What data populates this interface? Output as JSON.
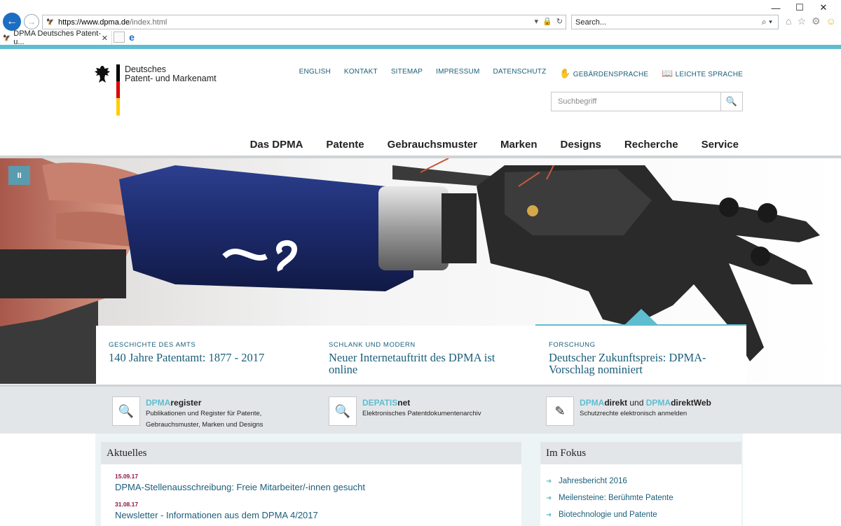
{
  "browser": {
    "url_host": "https://www.dpma.de",
    "url_path": "/index.html",
    "search_placeholder": "Search...",
    "tab_title": "DPMA Deutsches Patent- u..."
  },
  "header": {
    "logo_line1": "Deutsches",
    "logo_line2": "Patent- und Markenamt",
    "topnav": [
      "ENGLISH",
      "KONTAKT",
      "SITEMAP",
      "IMPRESSUM",
      "DATENSCHUTZ",
      "GEBÄRDENSPRACHE",
      "LEICHTE SPRACHE"
    ],
    "search_placeholder": "Suchbegriff",
    "mainnav": [
      "Das DPMA",
      "Patente",
      "Gebrauchsmuster",
      "Marken",
      "Designs",
      "Recherche",
      "Service"
    ]
  },
  "hero": {
    "pause_label": "II",
    "teasers": [
      {
        "kicker": "GESCHICHTE DES AMTS",
        "title": "140 Jahre Patentamt: 1877 - 2017"
      },
      {
        "kicker": "SCHLANK UND MODERN",
        "title": "Neuer Internetauftritt des DPMA ist online"
      },
      {
        "kicker": "FORSCHUNG",
        "title": "Deutscher Zukunftspreis: DPMA-Vorschlag nominiert"
      }
    ]
  },
  "services": [
    {
      "prefix": "DPMA",
      "suffix": "register",
      "desc1": "Publikationen und Register für Patente,",
      "desc2": "Gebrauchsmuster, Marken und Designs"
    },
    {
      "prefix": "DEPATIS",
      "suffix": "net",
      "desc1": "Elektronisches Patentdokumentenarchiv",
      "desc2": ""
    },
    {
      "prefix": "DPMA",
      "suffix": "direkt",
      "middle": " und ",
      "prefix2": "DPMA",
      "suffix2": "direktWeb",
      "desc1": "Schutzrechte elektronisch anmelden",
      "desc2": ""
    }
  ],
  "news": {
    "heading": "Aktuelles",
    "items": [
      {
        "date": "15.09.17",
        "title": "DPMA-Stellenausschreibung: Freie Mitarbeiter/-innen gesucht"
      },
      {
        "date": "31.08.17",
        "title": "Newsletter - Informationen aus dem DPMA 4/2017"
      }
    ]
  },
  "focus": {
    "heading": "Im Fokus",
    "items": [
      "Jahresbericht 2016",
      "Meilensteine: Berühmte Patente",
      "Biotechnologie und Patente"
    ]
  }
}
